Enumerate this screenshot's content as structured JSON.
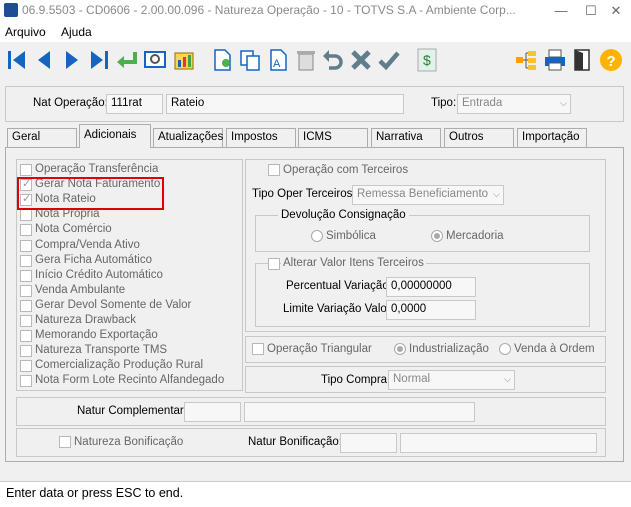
{
  "window": {
    "title": "06.9.5503 - CD0606 - 2.00.00.096 - Natureza Operação - 10 - TOTVS S.A - Ambiente Corp..."
  },
  "menu": {
    "items": [
      "Arquivo",
      "Ajuda"
    ]
  },
  "header": {
    "nat_operacao_label": "Nat Operação:",
    "nat_operacao_value": "111rat",
    "nat_operacao_desc": "Rateio",
    "tipo_label": "Tipo:",
    "tipo_value": "Entrada"
  },
  "tabs": [
    "Geral",
    "Adicionais",
    "Atualizações",
    "Impostos",
    "ICMS",
    "Narrativa",
    "Outros",
    "Importação"
  ],
  "active_tab": "Adicionais",
  "left_checks": [
    {
      "label": "Operação Transferência",
      "checked": false
    },
    {
      "label": "Gerar Nota Faturamento",
      "checked": true
    },
    {
      "label": "Nota Rateio",
      "checked": true
    },
    {
      "label": "Nota Própria",
      "checked": false
    },
    {
      "label": "Nota Comércio",
      "checked": false
    },
    {
      "label": "Compra/Venda Ativo",
      "checked": false
    },
    {
      "label": "Gera Ficha Automático",
      "checked": false
    },
    {
      "label": "Início Crédito Automático",
      "checked": false
    },
    {
      "label": "Venda Ambulante",
      "checked": false
    },
    {
      "label": "Gerar Devol Somente de Valor",
      "checked": false
    },
    {
      "label": "Natureza Drawback",
      "checked": false
    },
    {
      "label": "Memorando Exportação",
      "checked": false
    },
    {
      "label": "Natureza Transporte TMS",
      "checked": false
    },
    {
      "label": "Comercialização Produção Rural",
      "checked": false
    },
    {
      "label": "Nota Form Lote Recinto Alfandegado",
      "checked": false
    }
  ],
  "terceiros": {
    "operacao_label": "Operação com Terceiros",
    "tipo_oper_label": "Tipo Oper Terceiros:",
    "tipo_oper_value": "Remessa Beneficiamento",
    "devolucao_title": "Devolução Consignação",
    "radio_simbolica": "Simbólica",
    "radio_mercadoria": "Mercadoria",
    "alterar_label": "Alterar Valor Itens Terceiros",
    "percentual_label": "Percentual Variação:",
    "percentual_value": "0,00000000",
    "limite_label": "Limite Variação Valor:",
    "limite_value": "0,0000"
  },
  "triangular": {
    "label": "Operação Triangular",
    "radio_industrializacao": "Industrialização",
    "radio_venda": "Venda à Ordem"
  },
  "compra": {
    "label": "Tipo Compra:",
    "value": "Normal"
  },
  "complementar": {
    "label": "Natur Complementar:"
  },
  "bonificacao": {
    "check_label": "Natureza Bonificação",
    "label": "Natur Bonificação:"
  },
  "status": {
    "text": "Enter data or press ESC to end."
  },
  "colors": {
    "highlight": "#dd0000",
    "toolbar_blue": "#1565c0",
    "toolbar_green": "#2e7d32"
  },
  "toolbar_icons": [
    "first-icon",
    "prev-icon",
    "next-icon",
    "last-icon",
    "return-icon",
    "zoom-icon",
    "report-icon",
    "new-icon",
    "copy-icon",
    "edit-icon",
    "delete-icon",
    "undo-icon",
    "cancel-icon",
    "save-icon",
    "money-icon",
    "tree-icon",
    "print-icon",
    "exit-icon",
    "help-icon"
  ]
}
